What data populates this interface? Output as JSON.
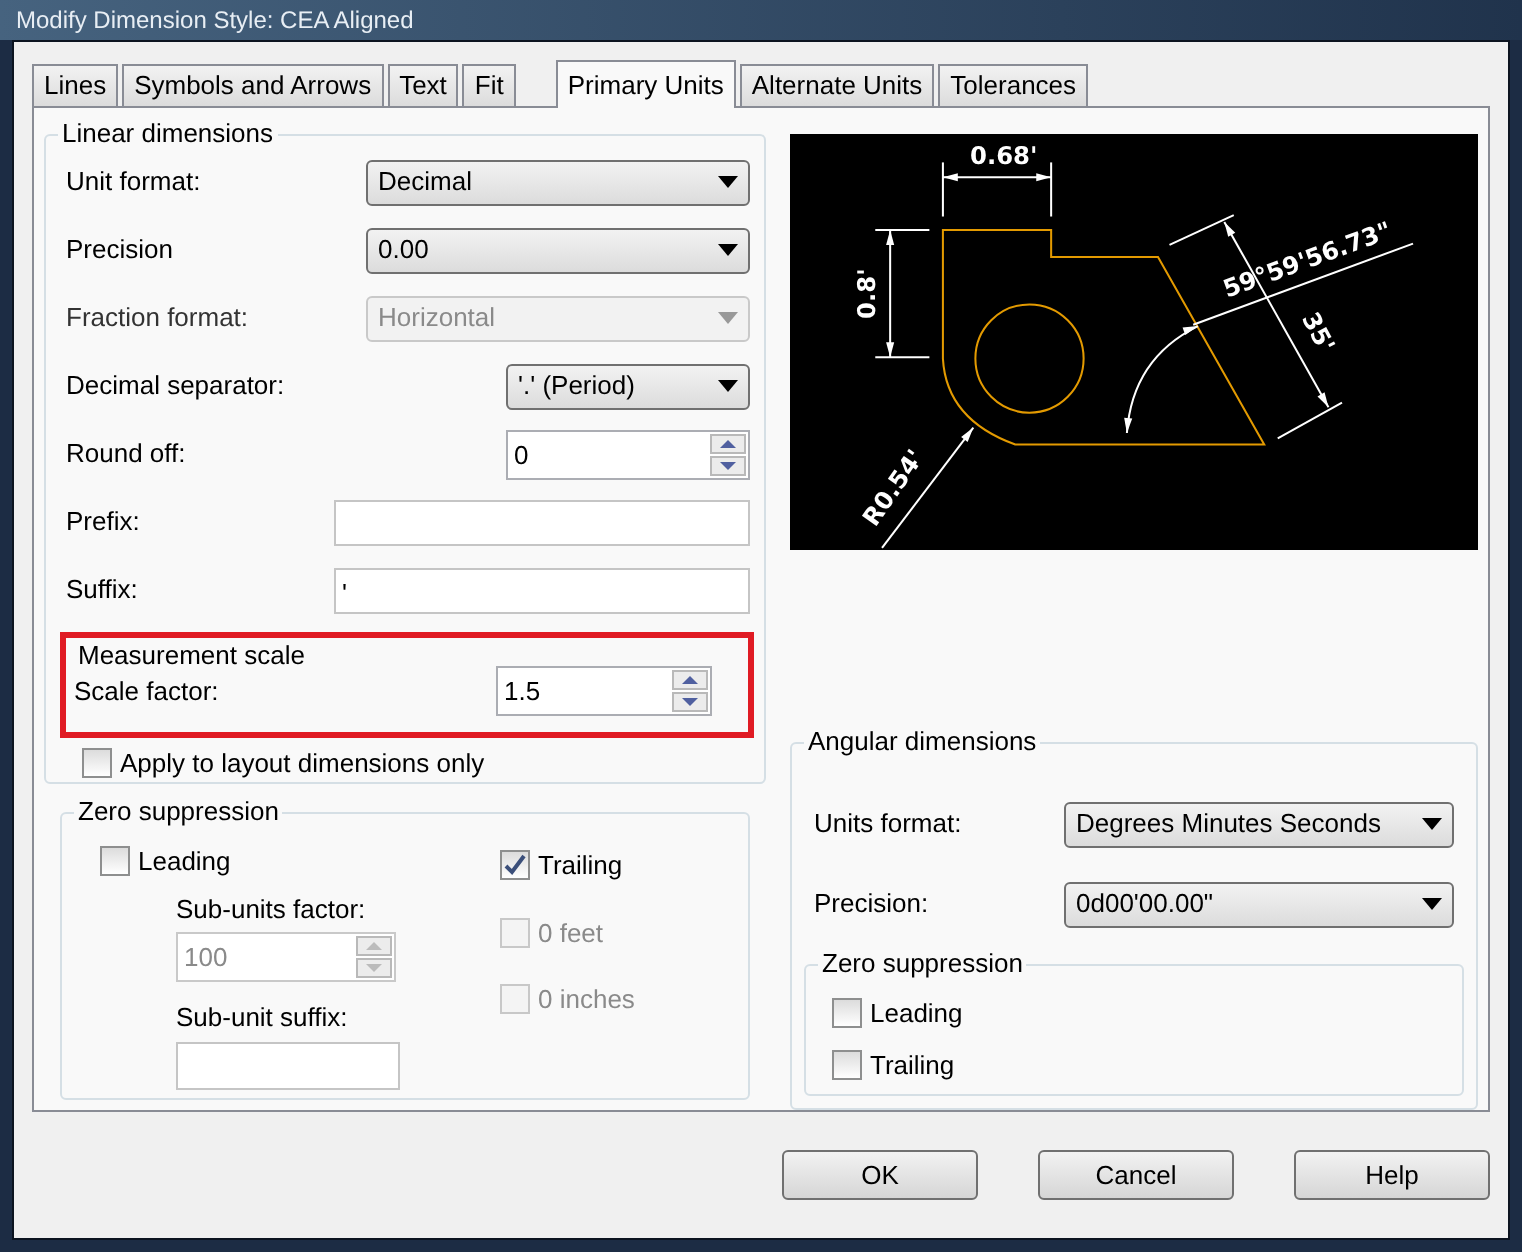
{
  "window": {
    "title": "Modify Dimension Style: CEA Aligned"
  },
  "tabs": [
    {
      "label": "Lines",
      "selected": false
    },
    {
      "label": "Symbols and Arrows",
      "selected": false
    },
    {
      "label": "Text",
      "selected": false
    },
    {
      "label": "Fit",
      "selected": false
    },
    {
      "label": "Primary Units",
      "selected": true
    },
    {
      "label": "Alternate Units",
      "selected": false
    },
    {
      "label": "Tolerances",
      "selected": false
    }
  ],
  "linear_dimensions": {
    "title": "Linear dimensions",
    "fields": [
      {
        "kind": "dropdown",
        "label": "Unit format:",
        "value": "Decimal",
        "disabled": false
      },
      {
        "kind": "dropdown",
        "label": "Precision",
        "value": "0.00",
        "disabled": false
      },
      {
        "kind": "dropdown",
        "label": "Fraction format:",
        "value": "Horizontal",
        "disabled": true
      },
      {
        "kind": "dropdown",
        "label": "Decimal separator:",
        "value": "'.' (Period)",
        "disabled": false
      },
      {
        "kind": "spinner",
        "label": "Round off:",
        "value": "0",
        "disabled": false
      },
      {
        "kind": "text",
        "label": "Prefix:"
      },
      {
        "kind": "text",
        "label": "Suffix:",
        "value": "'"
      }
    ]
  },
  "measurement_scale": {
    "title": "Measurement scale",
    "highlighted": true,
    "scale_factor": {
      "label": "Scale factor:",
      "value": "1.5"
    },
    "apply_layout": {
      "label": "Apply to layout dimensions only",
      "checked": false
    }
  },
  "zero_suppression": {
    "title": "Zero suppression",
    "leading": {
      "label": "Leading",
      "checked": false
    },
    "sub_units_factor": {
      "label": "Sub-units factor:",
      "value": "100",
      "disabled": true
    },
    "sub_unit_suffix": {
      "label": "Sub-unit suffix:"
    },
    "trailing": [
      {
        "label": "Trailing",
        "checked": true,
        "disabled": false
      },
      {
        "label": "0 feet",
        "checked": false,
        "disabled": true
      },
      {
        "label": "0 inches",
        "checked": false,
        "disabled": true
      }
    ]
  },
  "preview": {
    "labels": [
      "0.68'",
      "0.8'",
      "59°59'56.73\"",
      "35'",
      "R0.54'"
    ]
  },
  "angular_dimensions": {
    "title": "Angular dimensions",
    "units_format": {
      "label": "Units format:",
      "value": "Degrees Minutes Seconds"
    },
    "precision": {
      "label": "Precision:",
      "value": "0d00'00.00\""
    },
    "zero_suppression": {
      "title": "Zero suppression",
      "items": [
        {
          "label": "Leading",
          "checked": false
        },
        {
          "label": "Trailing",
          "checked": false
        }
      ]
    }
  },
  "buttons": [
    "OK",
    "Cancel",
    "Help"
  ]
}
